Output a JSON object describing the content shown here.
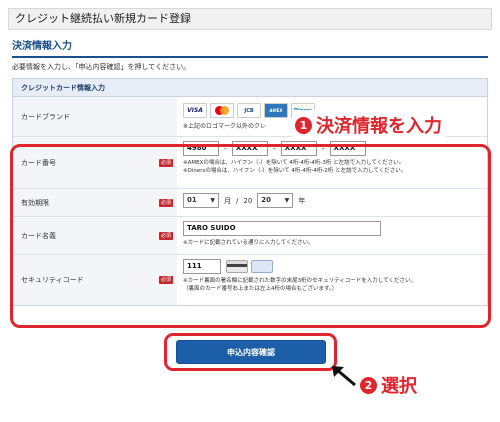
{
  "header": {
    "title": "クレジット継続払い新規カード登録"
  },
  "section": {
    "title": "決済情報入力",
    "instruction": "必要情報を入力し、「申込内容確認」を押してください。"
  },
  "form": {
    "table_title": "クレジットカード情報入力",
    "required_badge": "必須",
    "brand": {
      "label": "カードブランド",
      "logos": [
        "VISA",
        "JCB",
        "AMEX",
        "Diners"
      ],
      "note": "※上記のロゴマーク以外のクレ"
    },
    "card_number": {
      "label": "カード番号",
      "values": [
        "4980",
        "XXXX",
        "XXXX",
        "XXXX"
      ],
      "separator": "-",
      "note_amex": "※AMEXの場合は、ハイフン（-）を除いて 4桁-4桁-4桁-3桁 と左詰で入力してください。",
      "note_diners": "※Dinersの場合は、ハイフン（-）を除いて 4桁-4桁-4桁-2桁 と左詰で入力してください。"
    },
    "expiry": {
      "label": "有効期限",
      "month_value": "01",
      "month_unit": "月",
      "separator": "/",
      "year_prefix": "20",
      "year_value": "20",
      "year_unit": "年"
    },
    "card_name": {
      "label": "カード名義",
      "value": "TARO SUIDO",
      "note": "※カードに記載されている通りに入力してください。"
    },
    "security_code": {
      "label": "セキュリティコード",
      "value": "111",
      "note_1": "※カード裏面の署名欄に記載された数字の末尾3桁のセキュリティコードを入力してください。",
      "note_2": "（裏面のカード番号右上または左上4桁の場合もございます。）"
    }
  },
  "submit": {
    "label": "申込内容確認"
  },
  "annotations": {
    "step1_number": "1",
    "step1_text": "決済情報を入力",
    "step2_number": "2",
    "step2_text": "選択",
    "color": "#e0262d"
  },
  "colors": {
    "accent": "#1a4f8a",
    "button": "#1d5ea8",
    "required": "#c4282d"
  }
}
